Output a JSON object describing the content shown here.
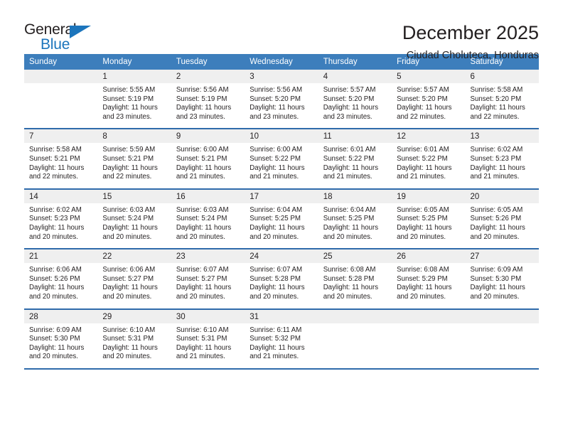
{
  "logo": {
    "word_one": "General",
    "word_two": "Blue",
    "triangle_icon": "triangle-right-icon",
    "blue": "#1c75bc"
  },
  "header": {
    "title": "December 2025",
    "subtitle": "Ciudad Choluteca, Honduras"
  },
  "colors": {
    "header_blue": "#3d7ebc",
    "row_divider_blue": "#2f6bab",
    "daynum_band": "#efefef",
    "text": "#231f20"
  },
  "calendar": {
    "weekday_headers": [
      "Sunday",
      "Monday",
      "Tuesday",
      "Wednesday",
      "Thursday",
      "Friday",
      "Saturday"
    ],
    "weeks": [
      [
        {
          "day": "",
          "lines": []
        },
        {
          "day": "1",
          "lines": [
            "Sunrise: 5:55 AM",
            "Sunset: 5:19 PM",
            "Daylight: 11 hours",
            "and 23 minutes."
          ]
        },
        {
          "day": "2",
          "lines": [
            "Sunrise: 5:56 AM",
            "Sunset: 5:19 PM",
            "Daylight: 11 hours",
            "and 23 minutes."
          ]
        },
        {
          "day": "3",
          "lines": [
            "Sunrise: 5:56 AM",
            "Sunset: 5:20 PM",
            "Daylight: 11 hours",
            "and 23 minutes."
          ]
        },
        {
          "day": "4",
          "lines": [
            "Sunrise: 5:57 AM",
            "Sunset: 5:20 PM",
            "Daylight: 11 hours",
            "and 23 minutes."
          ]
        },
        {
          "day": "5",
          "lines": [
            "Sunrise: 5:57 AM",
            "Sunset: 5:20 PM",
            "Daylight: 11 hours",
            "and 22 minutes."
          ]
        },
        {
          "day": "6",
          "lines": [
            "Sunrise: 5:58 AM",
            "Sunset: 5:20 PM",
            "Daylight: 11 hours",
            "and 22 minutes."
          ]
        }
      ],
      [
        {
          "day": "7",
          "lines": [
            "Sunrise: 5:58 AM",
            "Sunset: 5:21 PM",
            "Daylight: 11 hours",
            "and 22 minutes."
          ]
        },
        {
          "day": "8",
          "lines": [
            "Sunrise: 5:59 AM",
            "Sunset: 5:21 PM",
            "Daylight: 11 hours",
            "and 22 minutes."
          ]
        },
        {
          "day": "9",
          "lines": [
            "Sunrise: 6:00 AM",
            "Sunset: 5:21 PM",
            "Daylight: 11 hours",
            "and 21 minutes."
          ]
        },
        {
          "day": "10",
          "lines": [
            "Sunrise: 6:00 AM",
            "Sunset: 5:22 PM",
            "Daylight: 11 hours",
            "and 21 minutes."
          ]
        },
        {
          "day": "11",
          "lines": [
            "Sunrise: 6:01 AM",
            "Sunset: 5:22 PM",
            "Daylight: 11 hours",
            "and 21 minutes."
          ]
        },
        {
          "day": "12",
          "lines": [
            "Sunrise: 6:01 AM",
            "Sunset: 5:22 PM",
            "Daylight: 11 hours",
            "and 21 minutes."
          ]
        },
        {
          "day": "13",
          "lines": [
            "Sunrise: 6:02 AM",
            "Sunset: 5:23 PM",
            "Daylight: 11 hours",
            "and 21 minutes."
          ]
        }
      ],
      [
        {
          "day": "14",
          "lines": [
            "Sunrise: 6:02 AM",
            "Sunset: 5:23 PM",
            "Daylight: 11 hours",
            "and 20 minutes."
          ]
        },
        {
          "day": "15",
          "lines": [
            "Sunrise: 6:03 AM",
            "Sunset: 5:24 PM",
            "Daylight: 11 hours",
            "and 20 minutes."
          ]
        },
        {
          "day": "16",
          "lines": [
            "Sunrise: 6:03 AM",
            "Sunset: 5:24 PM",
            "Daylight: 11 hours",
            "and 20 minutes."
          ]
        },
        {
          "day": "17",
          "lines": [
            "Sunrise: 6:04 AM",
            "Sunset: 5:25 PM",
            "Daylight: 11 hours",
            "and 20 minutes."
          ]
        },
        {
          "day": "18",
          "lines": [
            "Sunrise: 6:04 AM",
            "Sunset: 5:25 PM",
            "Daylight: 11 hours",
            "and 20 minutes."
          ]
        },
        {
          "day": "19",
          "lines": [
            "Sunrise: 6:05 AM",
            "Sunset: 5:25 PM",
            "Daylight: 11 hours",
            "and 20 minutes."
          ]
        },
        {
          "day": "20",
          "lines": [
            "Sunrise: 6:05 AM",
            "Sunset: 5:26 PM",
            "Daylight: 11 hours",
            "and 20 minutes."
          ]
        }
      ],
      [
        {
          "day": "21",
          "lines": [
            "Sunrise: 6:06 AM",
            "Sunset: 5:26 PM",
            "Daylight: 11 hours",
            "and 20 minutes."
          ]
        },
        {
          "day": "22",
          "lines": [
            "Sunrise: 6:06 AM",
            "Sunset: 5:27 PM",
            "Daylight: 11 hours",
            "and 20 minutes."
          ]
        },
        {
          "day": "23",
          "lines": [
            "Sunrise: 6:07 AM",
            "Sunset: 5:27 PM",
            "Daylight: 11 hours",
            "and 20 minutes."
          ]
        },
        {
          "day": "24",
          "lines": [
            "Sunrise: 6:07 AM",
            "Sunset: 5:28 PM",
            "Daylight: 11 hours",
            "and 20 minutes."
          ]
        },
        {
          "day": "25",
          "lines": [
            "Sunrise: 6:08 AM",
            "Sunset: 5:28 PM",
            "Daylight: 11 hours",
            "and 20 minutes."
          ]
        },
        {
          "day": "26",
          "lines": [
            "Sunrise: 6:08 AM",
            "Sunset: 5:29 PM",
            "Daylight: 11 hours",
            "and 20 minutes."
          ]
        },
        {
          "day": "27",
          "lines": [
            "Sunrise: 6:09 AM",
            "Sunset: 5:30 PM",
            "Daylight: 11 hours",
            "and 20 minutes."
          ]
        }
      ],
      [
        {
          "day": "28",
          "lines": [
            "Sunrise: 6:09 AM",
            "Sunset: 5:30 PM",
            "Daylight: 11 hours",
            "and 20 minutes."
          ]
        },
        {
          "day": "29",
          "lines": [
            "Sunrise: 6:10 AM",
            "Sunset: 5:31 PM",
            "Daylight: 11 hours",
            "and 20 minutes."
          ]
        },
        {
          "day": "30",
          "lines": [
            "Sunrise: 6:10 AM",
            "Sunset: 5:31 PM",
            "Daylight: 11 hours",
            "and 21 minutes."
          ]
        },
        {
          "day": "31",
          "lines": [
            "Sunrise: 6:11 AM",
            "Sunset: 5:32 PM",
            "Daylight: 11 hours",
            "and 21 minutes."
          ]
        },
        {
          "day": "",
          "lines": []
        },
        {
          "day": "",
          "lines": []
        },
        {
          "day": "",
          "lines": []
        }
      ]
    ]
  }
}
